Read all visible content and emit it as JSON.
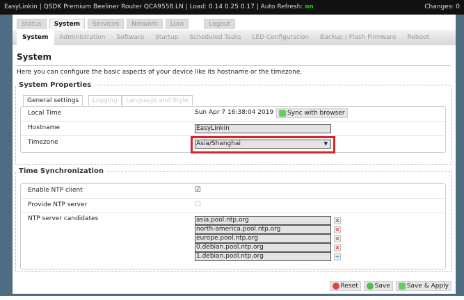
{
  "header": {
    "title": "EasyLinkin | QSDK Premium Beeliner Router QCA9558.LN | Load: 0.14 0.25 0.17 | Auto Refresh: ",
    "auto_refresh": "on",
    "changes": "Changes: 0"
  },
  "top_tabs": [
    "Status",
    "System",
    "Services",
    "Network",
    "Lora",
    "Logout"
  ],
  "sub_tabs": [
    "System",
    "Administration",
    "Software",
    "Startup",
    "Scheduled Tasks",
    "LED Configuration",
    "Backup / Flash Firmware",
    "Reboot"
  ],
  "page": {
    "title": "System",
    "description": "Here you can configure the basic aspects of your device like its hostname or the timezone."
  },
  "system_properties": {
    "legend": "System Properties",
    "tabs": [
      "General settings",
      "Logging",
      "Language and Style"
    ],
    "local_time_label": "Local Time",
    "local_time": "Sun Apr 7 16:38:04 2019",
    "sync_button": "Sync with browser",
    "hostname_label": "Hostname",
    "hostname": "EasyLinkin",
    "timezone_label": "Timezone",
    "timezone": "Asia/Shanghai"
  },
  "time_sync": {
    "legend": "Time Synchronization",
    "enable_ntp_label": "Enable NTP client",
    "enable_ntp": true,
    "provide_ntp_label": "Provide NTP server",
    "provide_ntp": false,
    "candidates_label": "NTP server candidates",
    "candidates": [
      "asia.pool.ntp.org",
      "north-america.pool.ntp.org",
      "europe.pool.ntp.org",
      "0.debian.pool.ntp.org",
      "1.debian.pool.ntp.org"
    ]
  },
  "buttons": {
    "reset": "Reset",
    "save": "Save",
    "save_apply": "Save & Apply"
  },
  "colors": {
    "highlight": "#d8232a",
    "sidebar": "#4e6d82"
  }
}
